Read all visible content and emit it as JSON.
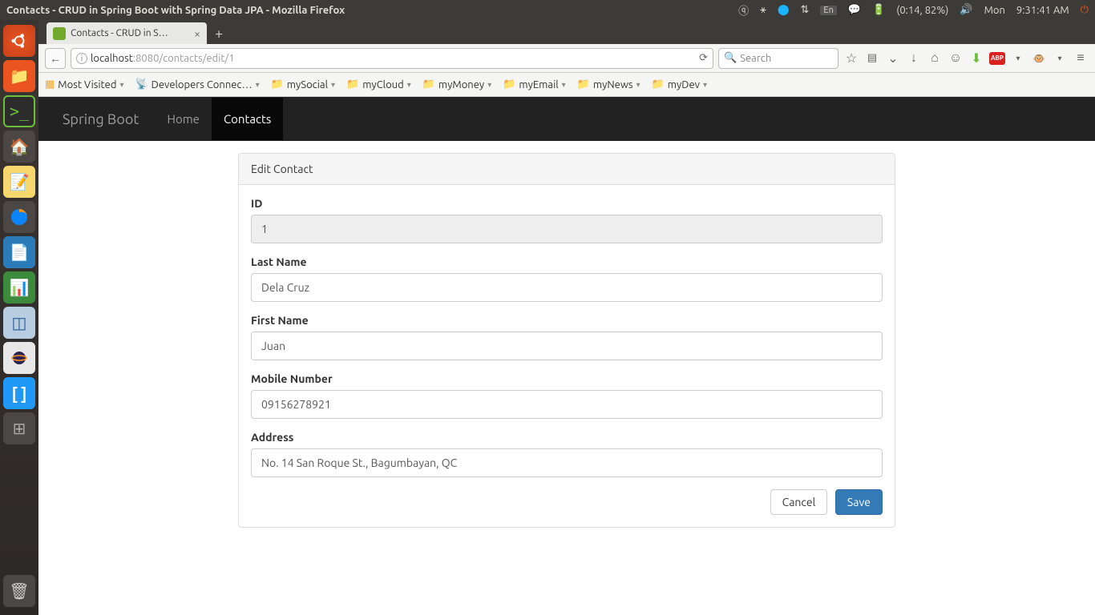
{
  "system": {
    "window_title": "Contacts - CRUD in Spring Boot with Spring Data JPA - Mozilla Firefox",
    "battery": "(0:14, 82%)",
    "day": "Mon",
    "time": "9:31:41 AM",
    "lang": "En"
  },
  "tab": {
    "title": "Contacts - CRUD in S…"
  },
  "url": {
    "host": "localhost",
    "port_path": ":8080/contacts/edit/1"
  },
  "search": {
    "placeholder": "Search"
  },
  "bookmarks": {
    "most_visited": "Most Visited",
    "developers": "Developers Connec…",
    "mysocial": "mySocial",
    "mycloud": "myCloud",
    "mymoney": "myMoney",
    "myemail": "myEmail",
    "mynews": "myNews",
    "mydev": "myDev"
  },
  "app": {
    "brand": "Spring Boot",
    "nav_home": "Home",
    "nav_contacts": "Contacts"
  },
  "panel": {
    "title": "Edit Contact"
  },
  "form": {
    "id_label": "ID",
    "id_value": "1",
    "lastname_label": "Last Name",
    "lastname_value": "Dela Cruz",
    "firstname_label": "First Name",
    "firstname_value": "Juan",
    "mobile_label": "Mobile Number",
    "mobile_value": "09156278921",
    "address_label": "Address",
    "address_value": "No. 14 San Roque St., Bagumbayan, QC",
    "cancel": "Cancel",
    "save": "Save"
  },
  "abp": "ABP"
}
